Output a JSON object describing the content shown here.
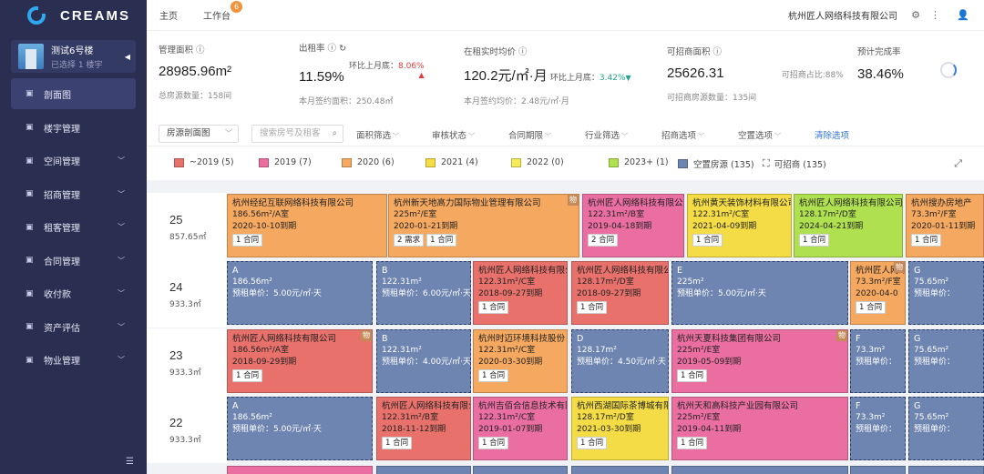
{
  "app": {
    "name": "CREAMS"
  },
  "building": {
    "name": "测试6号楼",
    "sub": "已选择 1 楼宇"
  },
  "nav": [
    {
      "label": "剖面图",
      "icon": "grid-icon",
      "active": true
    },
    {
      "label": "楼宇管理",
      "icon": "building-icon"
    },
    {
      "label": "空间管理",
      "icon": "space-icon",
      "caret": true
    },
    {
      "label": "招商管理",
      "icon": "invest-icon",
      "caret": true
    },
    {
      "label": "租客管理",
      "icon": "tenant-icon",
      "caret": true
    },
    {
      "label": "合同管理",
      "icon": "contract-icon",
      "caret": true
    },
    {
      "label": "收付款",
      "icon": "payment-icon",
      "caret": true
    },
    {
      "label": "资产评估",
      "icon": "chart-icon",
      "caret": true
    },
    {
      "label": "物业管理",
      "icon": "property-icon",
      "caret": true
    }
  ],
  "topbar": {
    "home": "主页",
    "workbench": "工作台",
    "badge": "6",
    "company": "杭州匠人网络科技有限公司"
  },
  "stats": {
    "mgmt_area": {
      "label": "管理面积",
      "value": "28985.96m²",
      "sub": "总房源数量：158间"
    },
    "occupancy": {
      "label": "出租率",
      "value": "11.59%",
      "trend_label": "环比上月底：",
      "trend": "8.06%",
      "sub": "本月签约面积：250.48㎡"
    },
    "avg_price": {
      "label": "在租实时均价",
      "value": "120.2元/㎡·月",
      "trend_label": "环比上月底：",
      "trend": "3.42%",
      "sub": "本月签约均价：2.48元/㎡·月"
    },
    "available": {
      "label": "可招商面积",
      "value": "25626.31",
      "ratio": "可招商占比:88%",
      "sub": "可招商房源数量：135间"
    },
    "forecast": {
      "label": "预计完成率",
      "value": "38.46%"
    }
  },
  "filters": {
    "view_select": "房源剖面图",
    "search_placeholder": "搜索房号及租客",
    "items": [
      "面积筛选",
      "审核状态",
      "合同期限",
      "行业筛选",
      "招商选项",
      "空置选项"
    ],
    "clear": "清除选项"
  },
  "legend": [
    {
      "label": "~2019 (5)",
      "color": "#e8716b"
    },
    {
      "label": "2019 (7)",
      "color": "#ea6fa0"
    },
    {
      "label": "2020 (6)",
      "color": "#f5a860"
    },
    {
      "label": "2021 (4)",
      "color": "#f4dc46"
    },
    {
      "label": "2022 (0)",
      "color": "#f5ec5a"
    },
    {
      "label": "2023+ (1)",
      "color": "#afe050"
    },
    {
      "label": "空置房源 (135)",
      "color": "#6d85b0"
    },
    {
      "label": "可招商 (135)",
      "icon": "corners-icon"
    }
  ],
  "floors": [
    {
      "num": "25",
      "area": "857.65㎡",
      "cells": [
        {
          "name": "杭州经纪互联网络科技有限公司",
          "area": "186.56m²/A室",
          "date": "2020-10-10到期",
          "tags": [
            "1 合同"
          ],
          "color": "#f5a860"
        },
        {
          "name": "杭州新天地高力国际物业管理有限公司",
          "area": "225m²/E室",
          "date": "2020-01-21到期",
          "tags": [
            "2 需求",
            "1 合同"
          ],
          "color": "#f5a860",
          "badge": "物"
        },
        {
          "name": "杭州匠人网络科技有限公司",
          "area": "122.31m²/B室",
          "date": "2019-04-18到期",
          "tags": [
            "2 合同"
          ],
          "color": "#ea6fa0"
        },
        {
          "name": "杭州黄天装饰材料有限公司",
          "area": "122.31m²/C室",
          "date": "2021-04-09到期",
          "tags": [
            "1 合同"
          ],
          "color": "#f4dc46"
        },
        {
          "name": "杭州匠人网络科技有限公司",
          "area": "128.17m²/D室",
          "date": "2024-04-21到期",
          "tags": [
            "1 合同"
          ],
          "color": "#afe050"
        },
        {
          "name": "杭州搜办房地产",
          "area": "73.3m²/F室",
          "date": "2020-01-11到期",
          "tags": [
            "1 合同"
          ],
          "color": "#f5a860"
        }
      ]
    },
    {
      "num": "24",
      "area": "933.3㎡",
      "cells": [
        {
          "name": "A",
          "area": "186.56m²",
          "price": "预租单价：5.00元/㎡·天",
          "vacant": true,
          "color": "#6d85b0"
        },
        {
          "name": "B",
          "area": "122.31m²",
          "price": "预租单价：6.00元/㎡·天",
          "vacant": true,
          "color": "#6d85b0"
        },
        {
          "name": "杭州匠人网络科技有限公司",
          "area": "122.31m²/C室",
          "date": "2018-09-27到期",
          "tags": [
            "1 合同"
          ],
          "color": "#e8716b"
        },
        {
          "name": "杭州匠人网络科技有限公司",
          "area": "128.17m²/D室",
          "date": "2018-09-27到期",
          "tags": [
            "1 合同"
          ],
          "color": "#e8716b"
        },
        {
          "name": "E",
          "area": "225m²",
          "price": "预租单价：5.00元/㎡·天",
          "vacant": true,
          "color": "#6d85b0"
        },
        {
          "name": "杭州匠人网络",
          "area": "73.3m²/F室",
          "date": "2020-04-0",
          "tags": [
            "1 合同"
          ],
          "color": "#f5a860",
          "badge": "物"
        },
        {
          "name": "G",
          "area": "75.65m²",
          "price": "预租单价：",
          "vacant": true,
          "color": "#6d85b0"
        }
      ]
    },
    {
      "num": "23",
      "area": "933.3㎡",
      "cells": [
        {
          "name": "杭州匠人网络科技有限公司",
          "area": "186.56m²/A室",
          "date": "2018-09-29到期",
          "tags": [
            "1 合同"
          ],
          "color": "#e8716b",
          "badge": "物"
        },
        {
          "name": "B",
          "area": "122.31m²",
          "price": "预租单价：4.00元/㎡·天",
          "vacant": true,
          "color": "#6d85b0"
        },
        {
          "name": "杭州时迈环境科技股份",
          "area": "122.31m²/C室",
          "date": "2020-03-30到期",
          "tags": [
            "1 合同"
          ],
          "color": "#f5a860"
        },
        {
          "name": "D",
          "area": "128.17m²",
          "price": "预租单价：4.50元/㎡·天",
          "vacant": true,
          "color": "#6d85b0"
        },
        {
          "name": "杭州天夏科技集团有限公司",
          "area": "225m²/E室",
          "date": "2019-05-09到期",
          "tags": [
            "1 合同"
          ],
          "color": "#ea6fa0",
          "badge": "物"
        },
        {
          "name": "F",
          "area": "73.3m²",
          "price": "预租单价：",
          "vacant": true,
          "color": "#6d85b0"
        },
        {
          "name": "G",
          "area": "75.65m²",
          "price": "预租单价：",
          "vacant": true,
          "color": "#6d85b0"
        }
      ]
    },
    {
      "num": "22",
      "area": "933.3㎡",
      "cells": [
        {
          "name": "A",
          "area": "186.56m²",
          "price": "预租单价：5.00元/㎡·天",
          "vacant": true,
          "color": "#6d85b0"
        },
        {
          "name": "杭州匠人网络科技有限公司",
          "area": "122.31m²/B室",
          "date": "2018-11-12到期",
          "tags": [
            "1 合同"
          ],
          "color": "#e8716b"
        },
        {
          "name": "杭州吉佰合信息技术有限公司",
          "area": "122.31m²/C室",
          "date": "2019-01-07到期",
          "tags": [
            "1 合同"
          ],
          "color": "#ea6fa0"
        },
        {
          "name": "杭州西湖国际茶博城有限公司",
          "area": "128.17m²/D室",
          "date": "2021-03-30到期",
          "tags": [
            "1 合同"
          ],
          "color": "#f4dc46"
        },
        {
          "name": "杭州天和高科技产业园有限公司",
          "area": "225m²/E室",
          "date": "2019-04-11到期",
          "tags": [
            "1 合同"
          ],
          "color": "#ea6fa0"
        },
        {
          "name": "F",
          "area": "73.3m²",
          "price": "预租单价：",
          "vacant": true,
          "color": "#6d85b0"
        },
        {
          "name": "G",
          "area": "75.65m²",
          "price": "预租单价：",
          "vacant": true,
          "color": "#6d85b0"
        }
      ]
    }
  ]
}
